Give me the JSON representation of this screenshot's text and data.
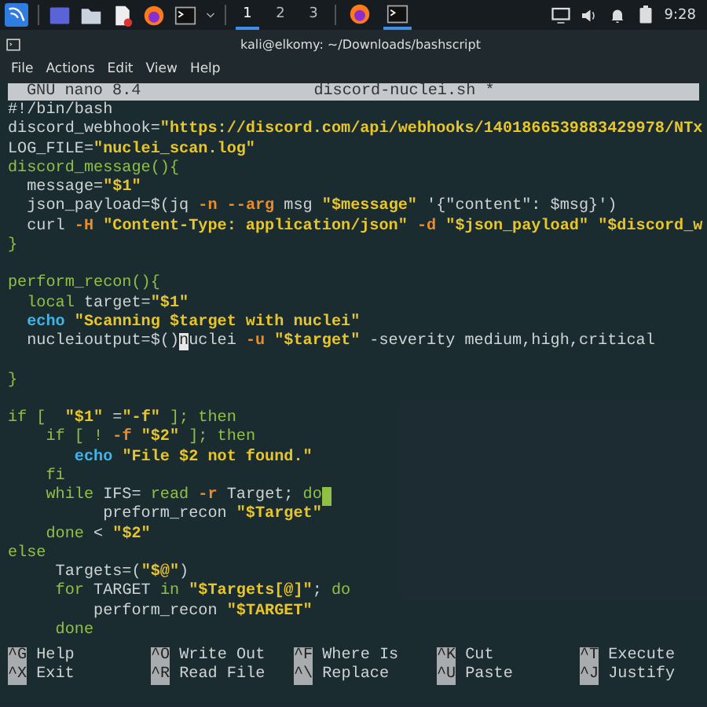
{
  "taskbar": {
    "workspaces": [
      {
        "label": "1",
        "selected": true
      },
      {
        "label": "2",
        "selected": false
      },
      {
        "label": "3",
        "selected": false
      }
    ],
    "tasks": [
      {
        "kind": "browser",
        "selected": false
      },
      {
        "kind": "terminal",
        "selected": true
      }
    ],
    "clock": "9:28"
  },
  "window": {
    "title": "kali@elkomy: ~/Downloads/bashscript",
    "menu": [
      "File",
      "Actions",
      "Edit",
      "View",
      "Help"
    ]
  },
  "nano": {
    "version": "GNU nano 8.4",
    "filename": "discord-nuclei.sh *",
    "lines": [
      {
        "kind": "code",
        "segments": [
          {
            "kind": "plain",
            "text": "#!/bin/bash"
          }
        ]
      },
      {
        "kind": "code",
        "segments": [
          {
            "kind": "plain",
            "text": "discord_webhook="
          },
          {
            "kind": "string",
            "text": "\"https://discord.com/api/webhooks/1401866539883429978/NTx"
          }
        ]
      },
      {
        "kind": "code",
        "segments": [
          {
            "kind": "plain",
            "text": "LOG_FILE="
          },
          {
            "kind": "string",
            "text": "\"nuclei_scan.log\""
          }
        ]
      },
      {
        "kind": "code",
        "segments": [
          {
            "kind": "keyword",
            "text": "discord_message(){"
          }
        ]
      },
      {
        "kind": "code",
        "segments": [
          {
            "kind": "plain",
            "text": "  message="
          },
          {
            "kind": "string",
            "text": "\"$1\""
          }
        ]
      },
      {
        "kind": "code",
        "segments": [
          {
            "kind": "plain",
            "text": "  json_payload=$(jq "
          },
          {
            "kind": "flag",
            "text": "-n --arg"
          },
          {
            "kind": "plain",
            "text": " msg "
          },
          {
            "kind": "string",
            "text": "\"$message\""
          },
          {
            "kind": "plain",
            "text": " '{\"content\": $msg}')"
          }
        ]
      },
      {
        "kind": "code",
        "segments": [
          {
            "kind": "plain",
            "text": "  curl "
          },
          {
            "kind": "flag",
            "text": "-H "
          },
          {
            "kind": "string",
            "text": "\"Content-Type: application/json\""
          },
          {
            "kind": "flag",
            "text": " -d "
          },
          {
            "kind": "string",
            "text": "\"$json_payload\" \"$discord_w"
          }
        ]
      },
      {
        "kind": "code",
        "segments": [
          {
            "kind": "keyword",
            "text": "}"
          }
        ]
      },
      {
        "kind": "blank"
      },
      {
        "kind": "code",
        "segments": [
          {
            "kind": "keyword",
            "text": "perform_recon(){"
          }
        ]
      },
      {
        "kind": "code",
        "segments": [
          {
            "kind": "keyword",
            "text": "  local"
          },
          {
            "kind": "plain",
            "text": " target="
          },
          {
            "kind": "string",
            "text": "\"$1\""
          }
        ]
      },
      {
        "kind": "code",
        "segments": [
          {
            "kind": "builtin",
            "text": "  echo "
          },
          {
            "kind": "string",
            "text": "\"Scanning $target with nuclei\""
          }
        ]
      },
      {
        "kind": "code",
        "segments": [
          {
            "kind": "plain",
            "text": "  nucleioutput=$()"
          },
          {
            "kind": "cursor",
            "text": "n"
          },
          {
            "kind": "plain",
            "text": "uclei "
          },
          {
            "kind": "flag",
            "text": "-u "
          },
          {
            "kind": "string",
            "text": "\"$target\""
          },
          {
            "kind": "plain",
            "text": " -severity medium,high,critical"
          }
        ]
      },
      {
        "kind": "blank"
      },
      {
        "kind": "code",
        "segments": [
          {
            "kind": "keyword",
            "text": "}"
          }
        ]
      },
      {
        "kind": "blank"
      },
      {
        "kind": "code",
        "segments": [
          {
            "kind": "keyword",
            "text": "if [  "
          },
          {
            "kind": "string",
            "text": "\"$1\""
          },
          {
            "kind": "plain",
            "text": " ="
          },
          {
            "kind": "string",
            "text": "\"-f\""
          },
          {
            "kind": "keyword",
            "text": " ]; then"
          }
        ]
      },
      {
        "kind": "code",
        "segments": [
          {
            "kind": "keyword",
            "text": "    if [ ! "
          },
          {
            "kind": "flag",
            "text": "-f "
          },
          {
            "kind": "string",
            "text": "\"$2\""
          },
          {
            "kind": "keyword",
            "text": " ]; then"
          }
        ]
      },
      {
        "kind": "code",
        "segments": [
          {
            "kind": "builtin",
            "text": "       echo "
          },
          {
            "kind": "string",
            "text": "\"File $2 not found.\""
          }
        ]
      },
      {
        "kind": "code",
        "segments": [
          {
            "kind": "keyword",
            "text": "    fi"
          }
        ]
      },
      {
        "kind": "code",
        "trailing_whitespace": true,
        "segments": [
          {
            "kind": "keyword",
            "text": "    while"
          },
          {
            "kind": "plain",
            "text": " IFS= "
          },
          {
            "kind": "keyword",
            "text": "read "
          },
          {
            "kind": "flag",
            "text": "-r"
          },
          {
            "kind": "plain",
            "text": " Target; "
          },
          {
            "kind": "keyword",
            "text": "do"
          }
        ]
      },
      {
        "kind": "code",
        "segments": [
          {
            "kind": "plain",
            "text": "          preform_recon "
          },
          {
            "kind": "string",
            "text": "\"$Target\""
          }
        ]
      },
      {
        "kind": "code",
        "segments": [
          {
            "kind": "keyword",
            "text": "    done"
          },
          {
            "kind": "plain",
            "text": " < "
          },
          {
            "kind": "string",
            "text": "\"$2\""
          }
        ]
      },
      {
        "kind": "code",
        "segments": [
          {
            "kind": "keyword",
            "text": "else"
          }
        ]
      },
      {
        "kind": "code",
        "segments": [
          {
            "kind": "plain",
            "text": "     Targets=("
          },
          {
            "kind": "string",
            "text": "\"$@\""
          },
          {
            "kind": "plain",
            "text": ")"
          }
        ]
      },
      {
        "kind": "code",
        "segments": [
          {
            "kind": "keyword",
            "text": "     for"
          },
          {
            "kind": "plain",
            "text": " TARGET "
          },
          {
            "kind": "keyword",
            "text": "in "
          },
          {
            "kind": "string",
            "text": "\"$Targets[@]\""
          },
          {
            "kind": "plain",
            "text": "; "
          },
          {
            "kind": "keyword",
            "text": "do"
          }
        ]
      },
      {
        "kind": "code",
        "segments": [
          {
            "kind": "plain",
            "text": "         perform_recon "
          },
          {
            "kind": "string",
            "text": "\"$TARGET\""
          }
        ]
      },
      {
        "kind": "code",
        "segments": [
          {
            "kind": "keyword",
            "text": "     done"
          }
        ]
      }
    ],
    "shortcuts": [
      {
        "key": "^G",
        "label": "Help"
      },
      {
        "key": "^O",
        "label": "Write Out"
      },
      {
        "key": "^F",
        "label": "Where Is"
      },
      {
        "key": "^K",
        "label": "Cut"
      },
      {
        "key": "^T",
        "label": "Execute"
      },
      {
        "key": "^X",
        "label": "Exit"
      },
      {
        "key": "^R",
        "label": "Read File"
      },
      {
        "key": "^\\",
        "label": "Replace"
      },
      {
        "key": "^U",
        "label": "Paste"
      },
      {
        "key": "^J",
        "label": "Justify"
      }
    ]
  }
}
